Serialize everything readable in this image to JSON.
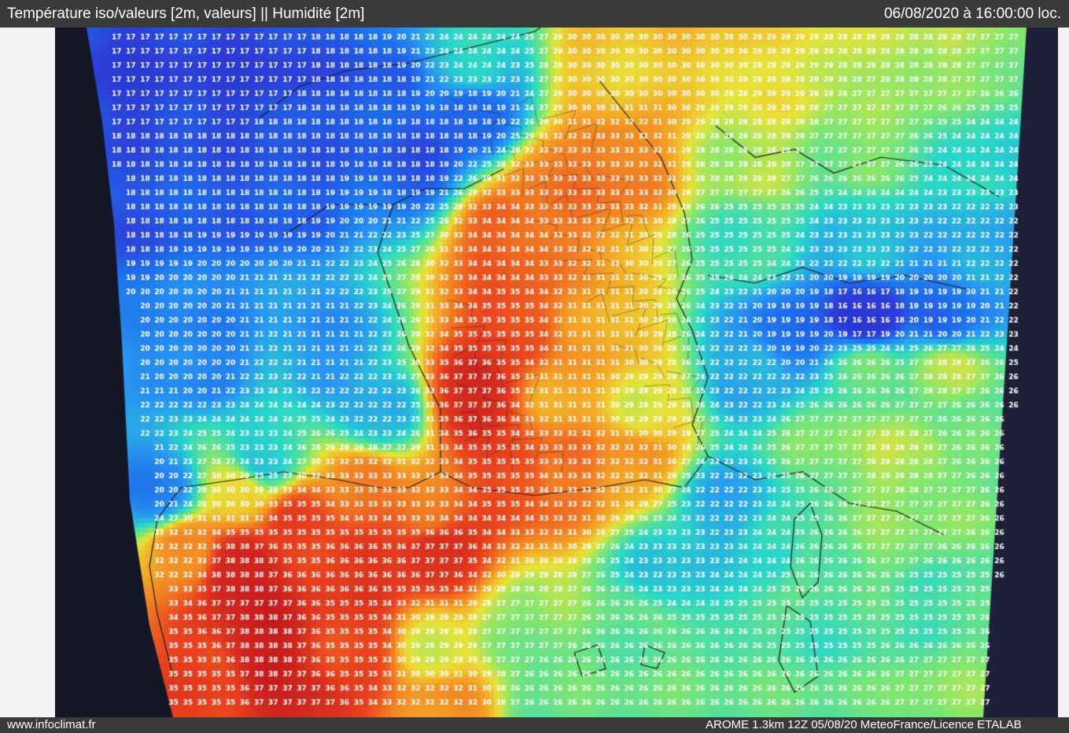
{
  "header": {
    "title": "Température iso/valeurs [2m, valeurs] || Humidité [2m]",
    "datetime": "06/08/2020 à 16:00:00 loc."
  },
  "footer": {
    "site": "www.infoclimat.fr",
    "credits": "AROME 1.3km 12Z 05/08/20 MeteoFrance/Licence ETALAB"
  },
  "map": {
    "type": "temperature-grid",
    "unit": "°C",
    "colors": {
      "cold": "#2c3fd8",
      "cool": "#2a8af0",
      "mild": "#29d6c8",
      "warm": "#e8e23a",
      "hot": "#f39a22",
      "very_hot": "#e8421e",
      "extreme": "#c81e1e",
      "land_outside": "#dcdce2",
      "border_lines": "#1a1a1a"
    },
    "sample_values": {
      "atlantic_north": 17,
      "atlantic_bay_biscay": 20,
      "english_channel": 18,
      "paris_region": 33,
      "central_france": 35,
      "southwest_france": 37,
      "spain_interior": 38,
      "alps": 19,
      "mediterranean": 25,
      "corsica": 26,
      "italy_north": 28,
      "germany_south": 26
    }
  }
}
